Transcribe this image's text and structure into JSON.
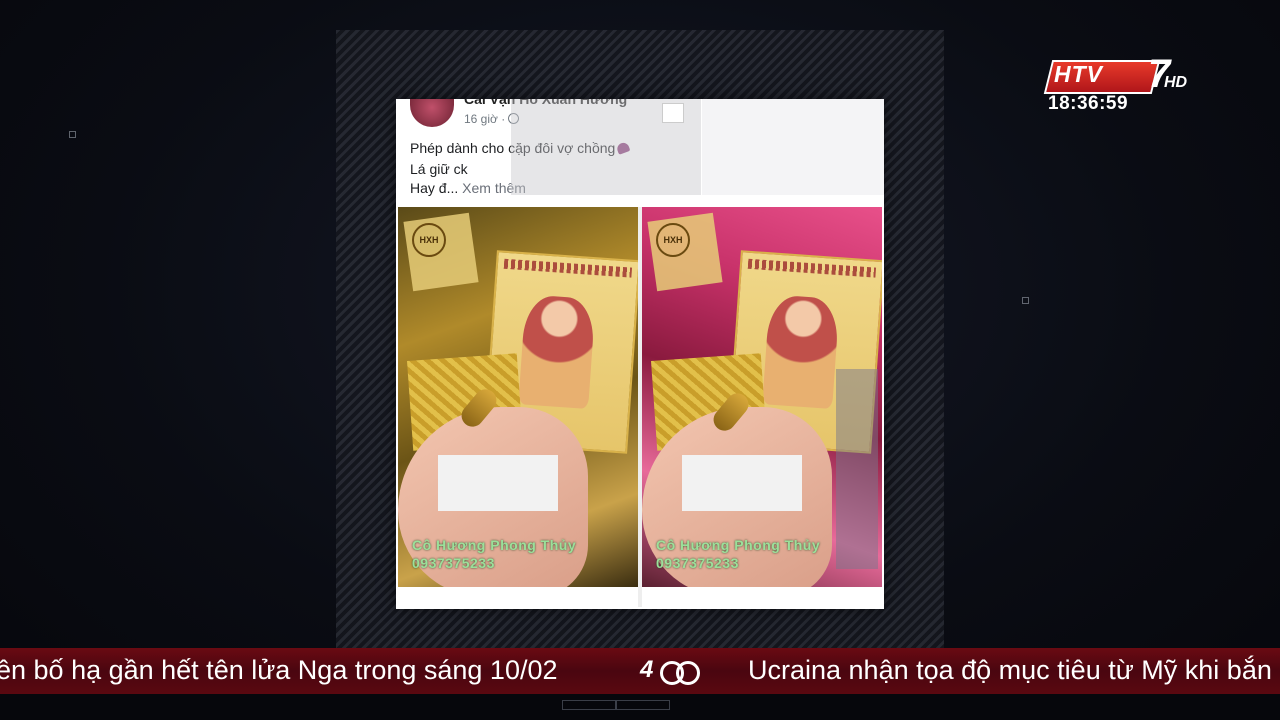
{
  "post": {
    "author": "Cai Vạn Hồ Xuân Hương",
    "time": "16 giờ ·",
    "line1": "Phép dành cho cặp đôi vợ chồng",
    "line2": "Lá giữ ck",
    "line3_prefix": "Hay đ...",
    "see_more": "Xem thêm"
  },
  "photos": {
    "left": {
      "logo": "HXH",
      "watermark": "Cô Hương Phong Thủy",
      "phone": "0937375233"
    },
    "right": {
      "logo": "HXH",
      "watermark": "Cô Hương Phong Thủy",
      "phone": "0937375233"
    }
  },
  "channel": {
    "name": "HTV",
    "number": "7",
    "quality": "HD",
    "time": "18:36:59"
  },
  "ticker": {
    "left_text": "ên bố hạ gần hết tên lửa Nga trong sáng 10/02",
    "right_text": "Ucraina nhận tọa độ mục tiêu từ Mỹ khi bắn",
    "logo": "4"
  },
  "colors": {
    "ticker_bg": "#5a0810",
    "logo_red": "#e83a2a",
    "watermark_green": "#9be09a"
  }
}
